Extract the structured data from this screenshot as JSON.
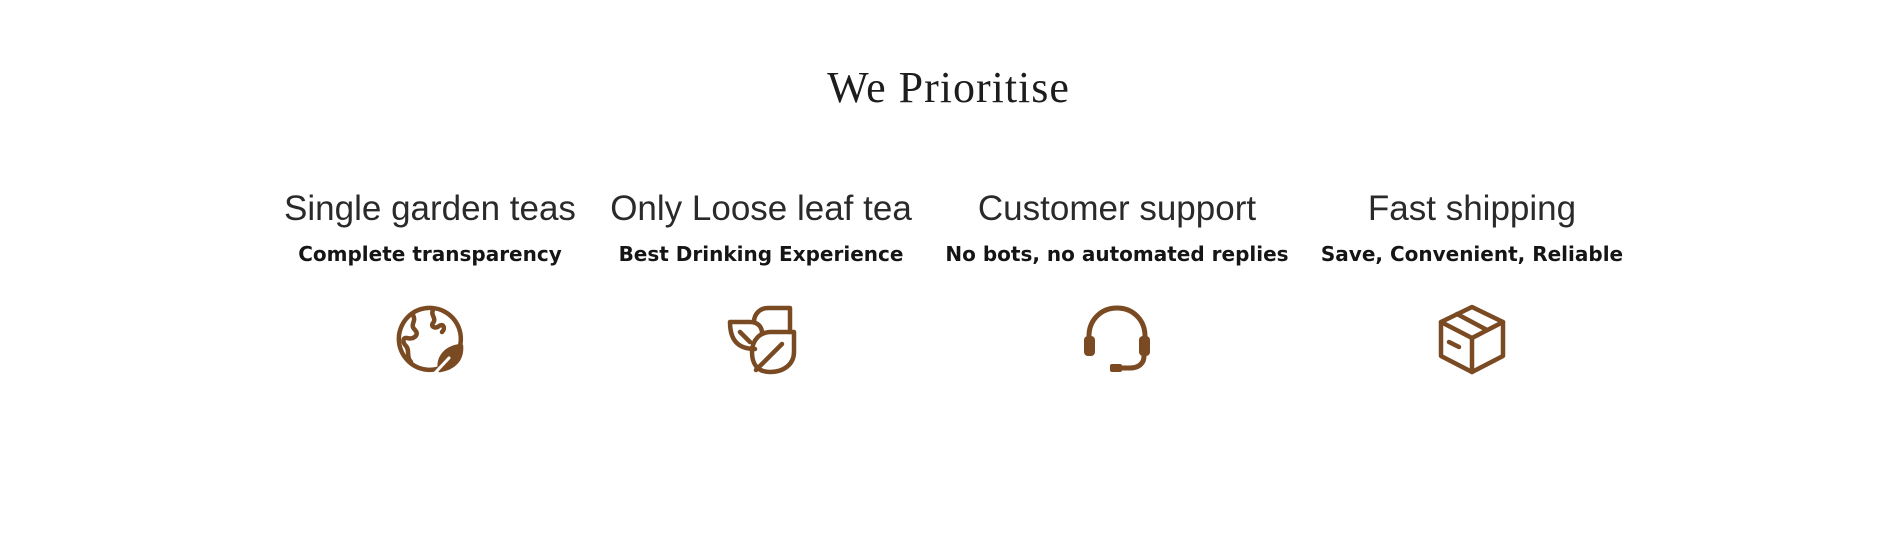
{
  "section": {
    "title": "We Prioritise"
  },
  "features": [
    {
      "title": "Single garden teas",
      "subtitle": "Complete transparency",
      "icon": "globe-leaf-icon"
    },
    {
      "title": "Only Loose leaf tea",
      "subtitle": "Best Drinking Experience",
      "icon": "leaves-icon"
    },
    {
      "title": "Customer support",
      "subtitle": "No bots, no automated replies",
      "icon": "headset-icon"
    },
    {
      "title": "Fast shipping",
      "subtitle": "Save, Convenient, Reliable",
      "icon": "box-icon"
    }
  ],
  "colors": {
    "icon": "#7a4a22",
    "title": "#2a2a2a",
    "subtitle": "#151515"
  }
}
